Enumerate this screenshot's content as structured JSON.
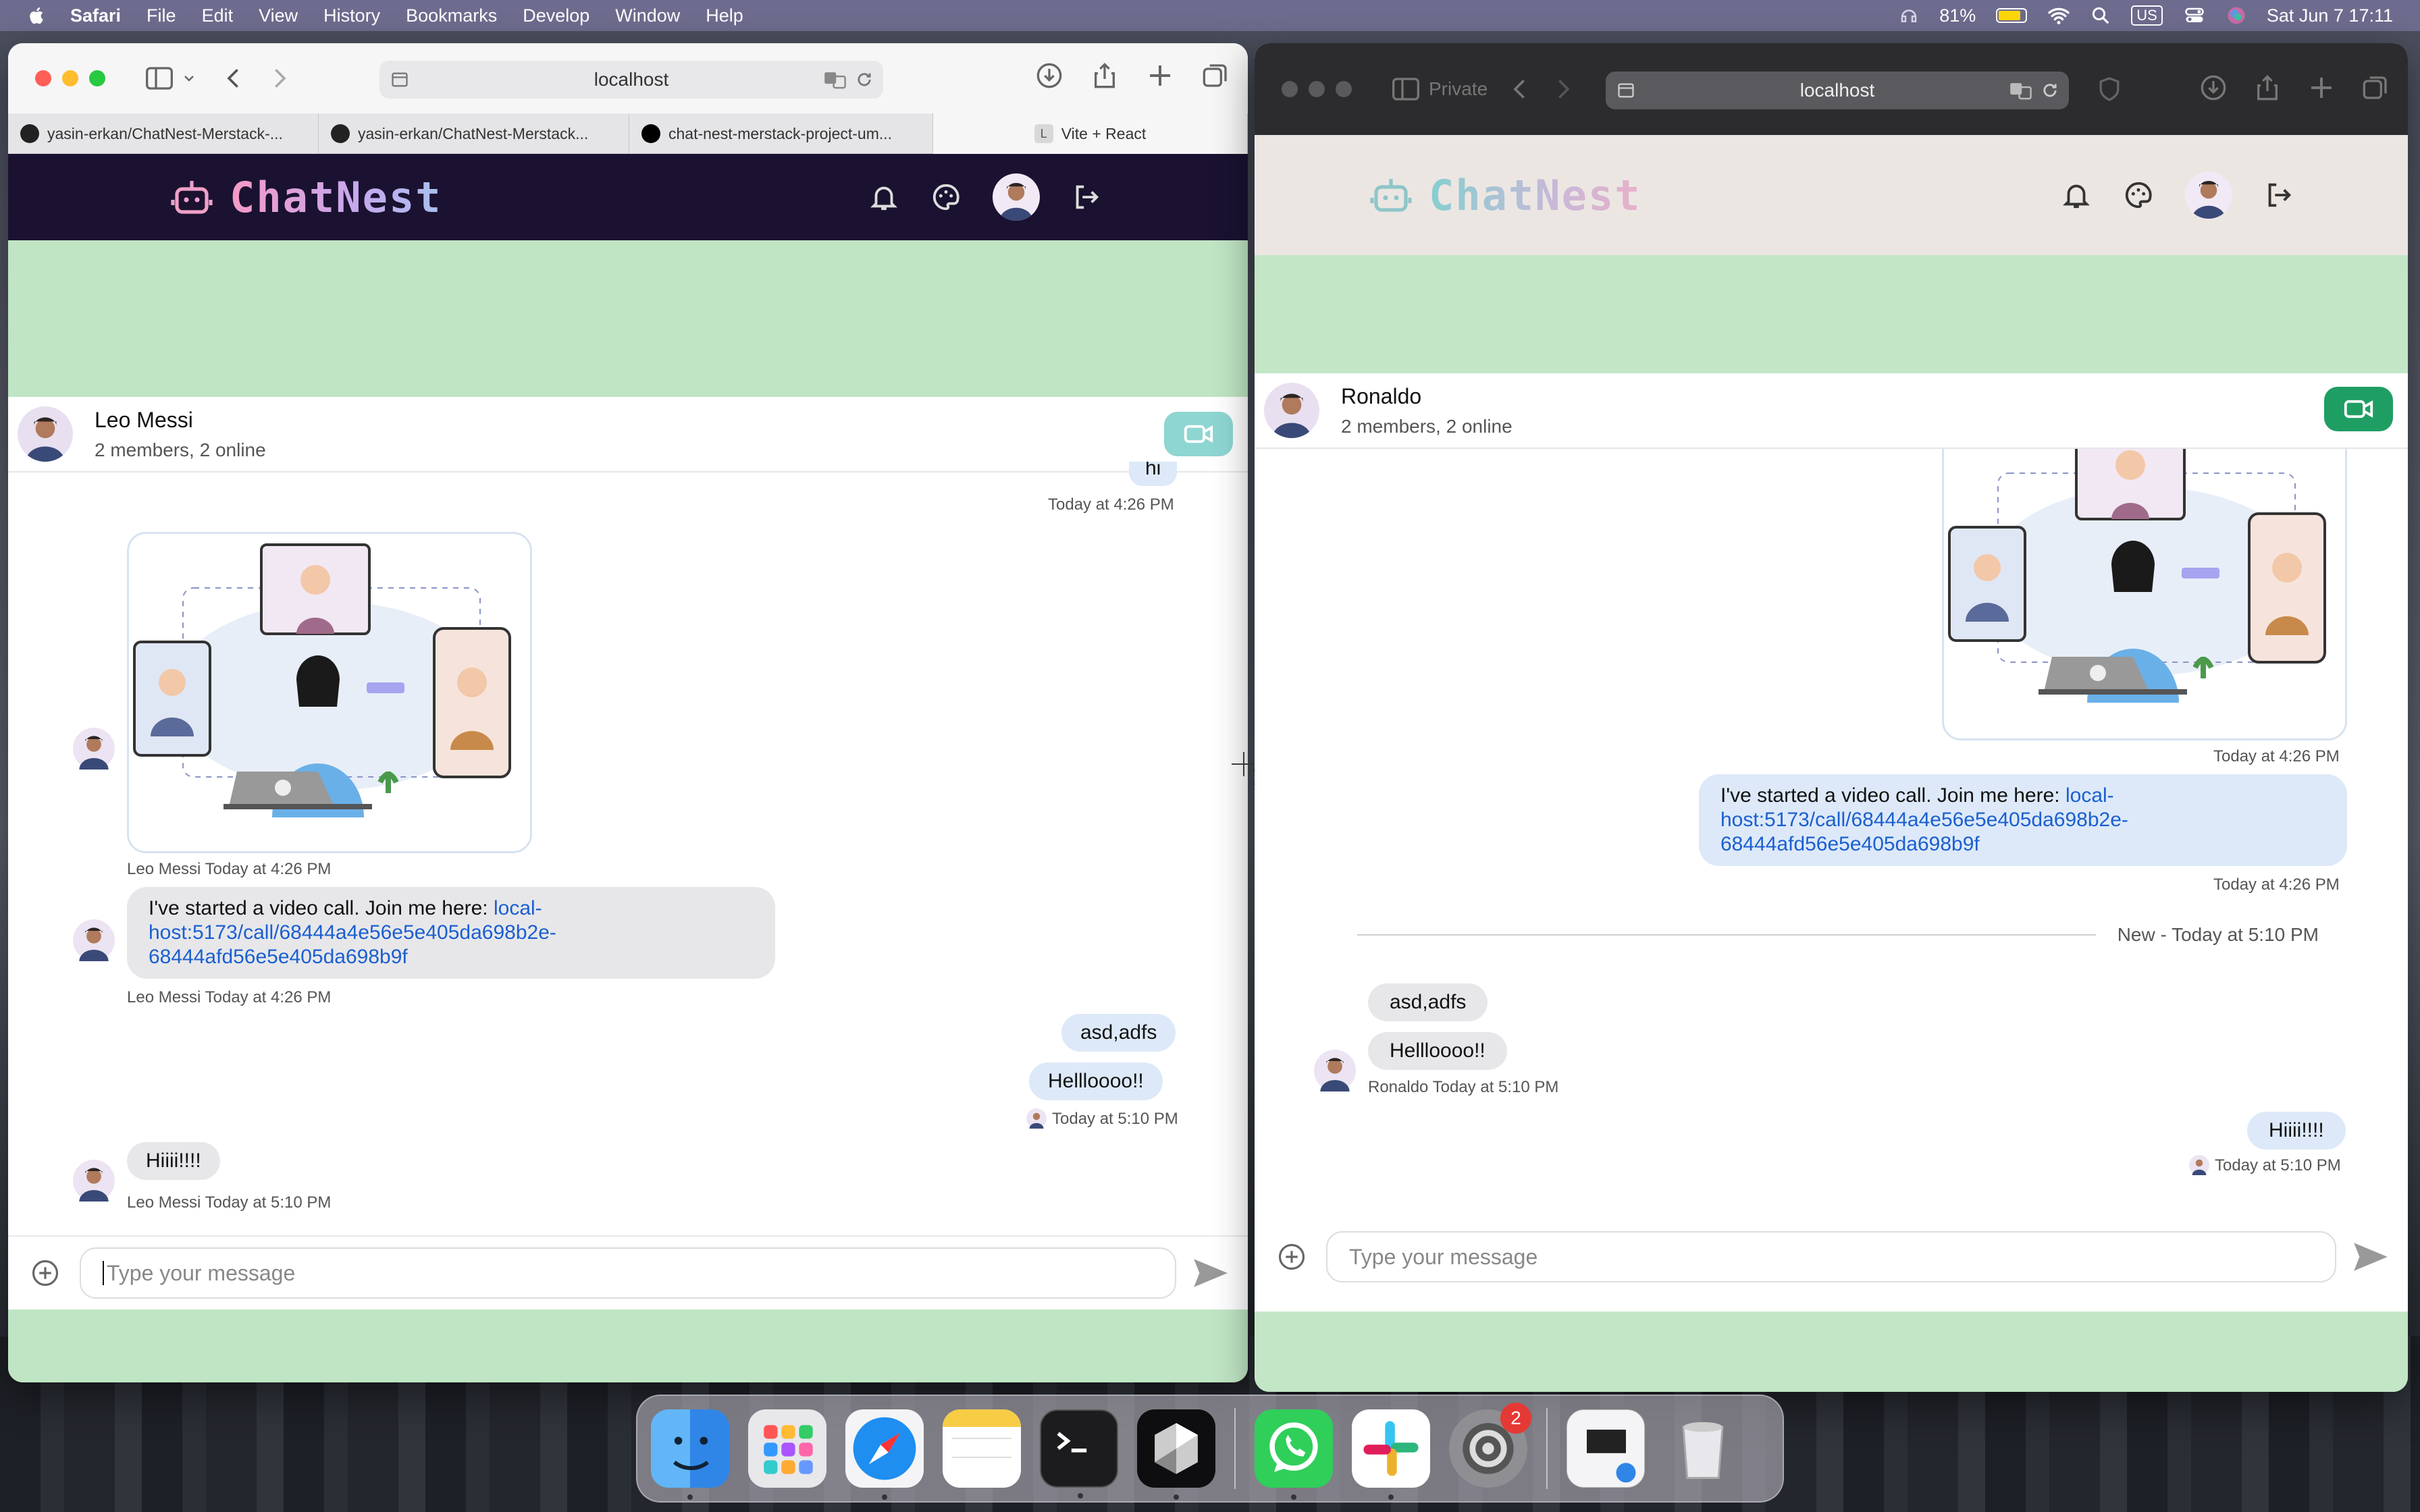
{
  "menubar": {
    "app": "Safari",
    "items": [
      "File",
      "Edit",
      "View",
      "History",
      "Bookmarks",
      "Develop",
      "Window",
      "Help"
    ],
    "battery": "81%",
    "input": "US",
    "datetime": "Sat Jun 7  17:11"
  },
  "left_window": {
    "url": "localhost",
    "tabs": [
      "yasin-erkan/ChatNest-Merstack-...",
      "yasin-erkan/ChatNest-Merstack...",
      "chat-nest-merstack-project-um...",
      "Vite + React"
    ],
    "brand": "ChatNest",
    "chat": {
      "name": "Leo Messi",
      "status": "2 members, 2 online",
      "top_bubble": "hi",
      "top_time": "Today at 4:26 PM",
      "img_meta": "Leo Messi Today at 4:26 PM",
      "call_prefix": "I've started a video call. Join me here: ",
      "call_link_1": "local-",
      "call_link_2": "host:5173/call/68444a4e56e5e405da698b2e-",
      "call_link_3": "68444afd56e5e405da698b9f",
      "call_meta": "Leo Messi Today at 4:26 PM",
      "out1": "asd,adfs",
      "out2": "Hellloooo!!",
      "out_meta": "Today at 5:10 PM",
      "in_last": "Hiiii!!!!",
      "in_last_meta": "Leo Messi Today at 5:10 PM",
      "placeholder": "Type your message"
    }
  },
  "right_window": {
    "private_label": "Private",
    "url": "localhost",
    "brand": "ChatNest",
    "chat": {
      "name": "Ronaldo",
      "status": "2 members, 2 online",
      "img_time": "Today at 4:26 PM",
      "call_prefix": "I've started a video call. Join me here: ",
      "call_link_1": "local-",
      "call_link_2": "host:5173/call/68444a4e56e5e405da698b2e-",
      "call_link_3": "68444afd56e5e405da698b9f",
      "call_time": "Today at 4:26 PM",
      "divider": "New - Today at 5:10 PM",
      "in1": "asd,adfs",
      "in2": "Hellloooo!!",
      "in_meta": "Ronaldo Today at 5:10 PM",
      "out_last": "Hiiii!!!!",
      "out_last_meta": "Today at 5:10 PM",
      "placeholder": "Type your message"
    }
  },
  "cursor_readout": {
    "x": "922",
    "y": "565"
  },
  "dock": {
    "apps": [
      "Finder",
      "Launchpad",
      "Safari",
      "Notes",
      "Terminal",
      "Cursor",
      "WhatsApp",
      "Slack",
      "System Settings",
      "Preview",
      "Trash"
    ],
    "settings_badge": "2"
  }
}
